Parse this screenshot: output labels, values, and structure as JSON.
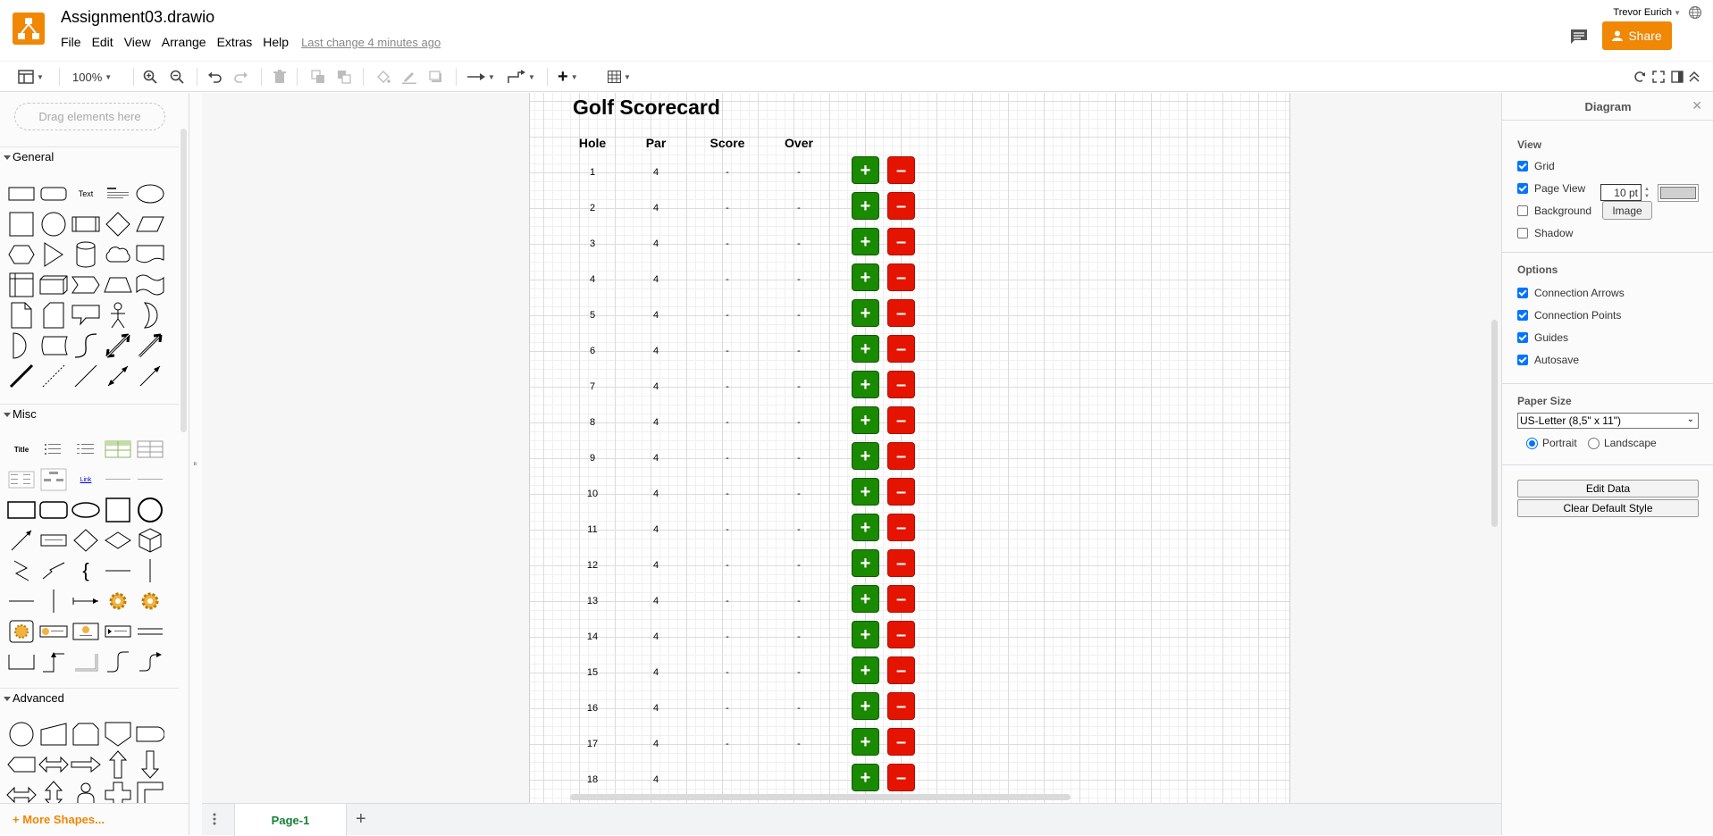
{
  "app": {
    "title": "Assignment03.drawio",
    "menus": [
      "File",
      "Edit",
      "View",
      "Arrange",
      "Extras",
      "Help"
    ],
    "last_change": "Last change 4 minutes ago",
    "user": "Trevor Eurich",
    "share_label": "Share",
    "accent_color": "#f08705"
  },
  "toolbar": {
    "zoom": "100%"
  },
  "sidebar": {
    "drag_hint": "Drag elements here",
    "sections": [
      "General",
      "Misc",
      "Advanced"
    ],
    "general_text_shape": "Text",
    "misc_title_shape": "Title",
    "more_shapes": "More Shapes..."
  },
  "scorecard": {
    "title": "Golf Scorecard",
    "headers": [
      "Hole",
      "Par",
      "Score",
      "Over"
    ],
    "plus_label": "+",
    "minus_label": "–",
    "plus_color": "#1a8a00",
    "minus_color": "#e51400",
    "rows": [
      {
        "hole": "1",
        "par": "4",
        "score": "-",
        "over": "-"
      },
      {
        "hole": "2",
        "par": "4",
        "score": "-",
        "over": "-"
      },
      {
        "hole": "3",
        "par": "4",
        "score": "-",
        "over": "-"
      },
      {
        "hole": "4",
        "par": "4",
        "score": "-",
        "over": "-"
      },
      {
        "hole": "5",
        "par": "4",
        "score": "-",
        "over": "-"
      },
      {
        "hole": "6",
        "par": "4",
        "score": "-",
        "over": "-"
      },
      {
        "hole": "7",
        "par": "4",
        "score": "-",
        "over": "-"
      },
      {
        "hole": "8",
        "par": "4",
        "score": "-",
        "over": "-"
      },
      {
        "hole": "9",
        "par": "4",
        "score": "-",
        "over": "-"
      },
      {
        "hole": "10",
        "par": "4",
        "score": "-",
        "over": "-"
      },
      {
        "hole": "11",
        "par": "4",
        "score": "-",
        "over": "-"
      },
      {
        "hole": "12",
        "par": "4",
        "score": "-",
        "over": "-"
      },
      {
        "hole": "13",
        "par": "4",
        "score": "-",
        "over": "-"
      },
      {
        "hole": "14",
        "par": "4",
        "score": "-",
        "over": "-"
      },
      {
        "hole": "15",
        "par": "4",
        "score": "-",
        "over": "-"
      },
      {
        "hole": "16",
        "par": "4",
        "score": "-",
        "over": "-"
      },
      {
        "hole": "17",
        "par": "4",
        "score": "-",
        "over": "-"
      },
      {
        "hole": "18",
        "par": "4",
        "score": "",
        "over": ""
      }
    ]
  },
  "pages": {
    "tabs": [
      "Page-1"
    ],
    "add_label": "+"
  },
  "format_panel": {
    "title": "Diagram",
    "view_heading": "View",
    "grid_label": "Grid",
    "grid_size": "10 pt",
    "page_view_label": "Page View",
    "background_label": "Background",
    "image_button": "Image",
    "shadow_label": "Shadow",
    "options_heading": "Options",
    "connection_arrows": "Connection Arrows",
    "connection_points": "Connection Points",
    "guides": "Guides",
    "autosave": "Autosave",
    "paper_heading": "Paper Size",
    "paper_size": "US-Letter (8,5\" x 11\")",
    "portrait": "Portrait",
    "landscape": "Landscape",
    "edit_data": "Edit Data",
    "clear_style": "Clear Default Style"
  }
}
